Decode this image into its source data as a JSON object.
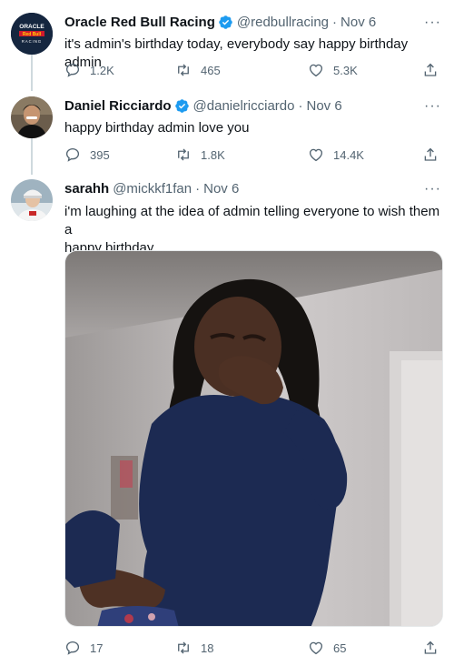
{
  "tweets": [
    {
      "name": "Oracle Red Bull Racing",
      "handle": "@redbullracing",
      "date": "Nov 6",
      "text": "it's admin's birthday today, everybody say happy birthday admin",
      "replies": "1.2K",
      "retweets": "465",
      "likes": "5.3K",
      "avatar_text_top": "ORACLE",
      "avatar_text_mid": "Red Bull",
      "avatar_text_bot": "RACING"
    },
    {
      "name": "Daniel Ricciardo",
      "handle": "@danielricciardo",
      "date": "Nov 6",
      "text": "happy birthday admin love you",
      "replies": "395",
      "retweets": "1.8K",
      "likes": "14.4K"
    },
    {
      "name": "sarahh",
      "handle": "@mickkf1fan",
      "date": "Nov 6",
      "text_line1": "i'm laughing at the idea of admin telling everyone to wish them a",
      "text_line2": "happy birthday",
      "replies": "17",
      "retweets": "18",
      "likes": "65"
    }
  ],
  "separator": "·",
  "more_glyph": "···",
  "colors": {
    "verified": "#1d9bf0",
    "secondary_text": "#536471",
    "thread_line": "#cfd9de"
  }
}
